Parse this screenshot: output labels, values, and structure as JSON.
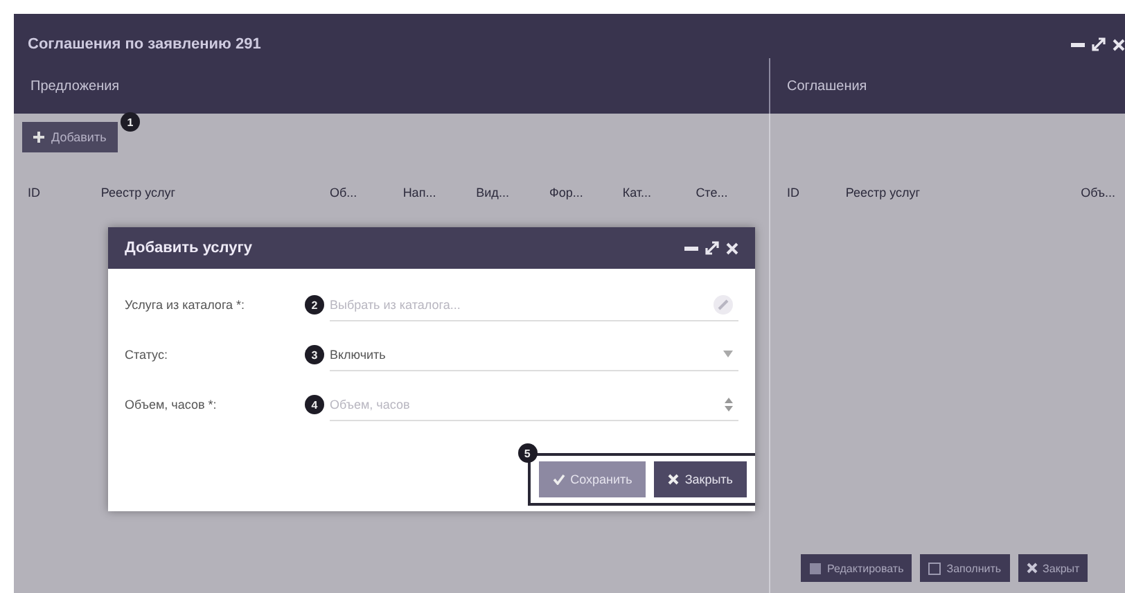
{
  "window": {
    "title": "Соглашения по заявлению 291"
  },
  "left_panel": {
    "title": "Предложения",
    "add_button": {
      "label": "Добавить",
      "callout": "1"
    },
    "columns": [
      "ID",
      "Реестр услуг",
      "Об...",
      "Нап...",
      "Вид...",
      "Фор...",
      "Кат...",
      "Сте..."
    ]
  },
  "right_panel": {
    "title": "Соглашения",
    "columns": [
      "ID",
      "Реестр услуг",
      "Объ..."
    ],
    "buttons": [
      {
        "kind": "edit",
        "label": "Редактировать"
      },
      {
        "kind": "fill",
        "label": "Заполнить"
      },
      {
        "kind": "close",
        "label": "Закрыт"
      }
    ]
  },
  "dialog": {
    "title": "Добавить услугу",
    "fields": [
      {
        "kind": "lookup",
        "label": "Услуга из каталога *:",
        "placeholder": "Выбрать из каталога...",
        "callout": "2"
      },
      {
        "kind": "select",
        "label": "Статус:",
        "value": "Включить",
        "callout": "3"
      },
      {
        "kind": "number",
        "label": "Объем, часов *:",
        "placeholder": "Объем, часов",
        "callout": "4"
      }
    ],
    "buttons": [
      {
        "kind": "save",
        "label": "Сохранить"
      },
      {
        "kind": "close",
        "label": "Закрыть"
      }
    ],
    "buttons_callout": "5"
  }
}
